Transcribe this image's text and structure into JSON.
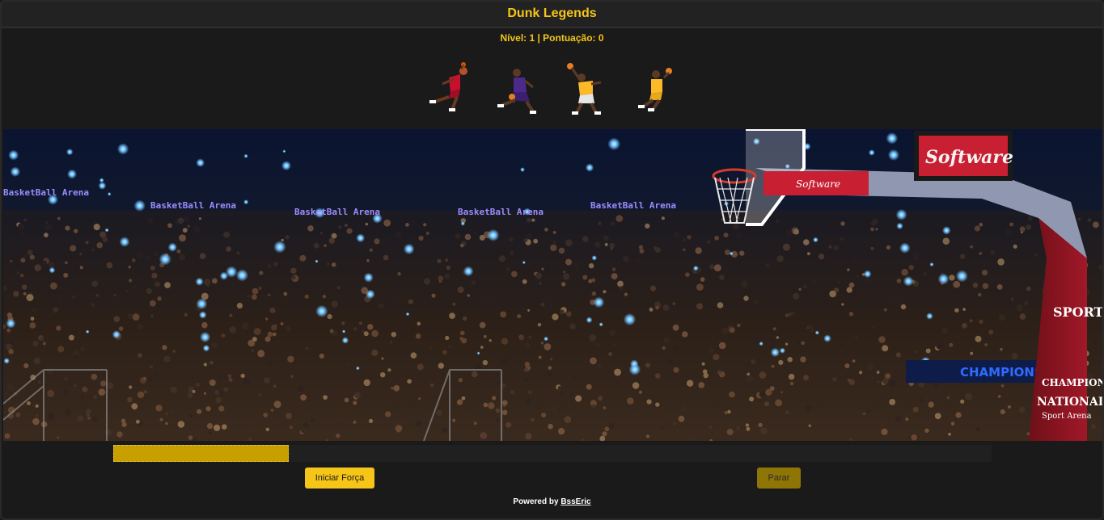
{
  "header": {
    "title": "Dunk Legends"
  },
  "status": {
    "text": "Nível: 1 | Pontuação: 0",
    "level": 1,
    "score": 0
  },
  "players": [
    {
      "name": "player-red-jersey",
      "jersey_color": "#c8102e",
      "shorts_color": "#c8102e"
    },
    {
      "name": "player-purple-jersey",
      "jersey_color": "#4b2a8c",
      "shorts_color": "#4b2a8c"
    },
    {
      "name": "player-gold-jersey-white",
      "jersey_color": "#fdb927",
      "shorts_color": "#e6e6e6"
    },
    {
      "name": "player-gold-jersey",
      "jersey_color": "#fdb927",
      "shorts_color": "#fdb927"
    }
  ],
  "arena": {
    "banners": [
      "BasketBall Arena",
      "BasketBall Arena",
      "BasketBall Arena",
      "BasketBall Arena",
      "BasketBall Arena"
    ],
    "sign_software": "Software",
    "backboard_label": "Software",
    "championship_sign": "CHAMPIONSHIP",
    "pillar_top": "SPORT",
    "pillar_line1": "CHAMPIONSHIP",
    "pillar_line2": "NATIONAL",
    "pillar_line3": "Sport Arena"
  },
  "power_meter": {
    "fill_fraction": 0.2
  },
  "controls": {
    "start_label": "Iniciar Força",
    "stop_label": "Parar"
  },
  "footer": {
    "prefix": "Powered by",
    "author": "BssEric"
  },
  "colors": {
    "accent": "#f5c518",
    "stop_button": "#8f7406",
    "background": "#1a1a1a"
  }
}
